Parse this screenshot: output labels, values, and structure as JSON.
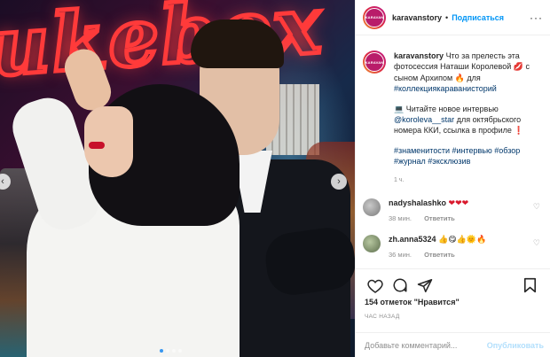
{
  "photo": {
    "neon_text": "ukebox",
    "nav_prev": "‹",
    "nav_next": "›",
    "carousel_dots": 4,
    "active_dot": 0
  },
  "header": {
    "username": "karavanstory",
    "separator": "•",
    "follow_label": "Подписаться",
    "more_label": "···",
    "avatar_text": "KARAVAN"
  },
  "caption": {
    "username": "karavanstory",
    "text1": "Что за прелесть эта фотосессия Наташи Королевой",
    "emoji_lips": "💋",
    "text2": "с сыном Архипом",
    "emoji_fire": "🔥",
    "text3": "для",
    "hashtag1": "#коллекциякараванисторий",
    "emoji_laptop": "💻",
    "text4": "Читайте новое интервью",
    "mention": "@koroleva__star",
    "text5": "для октябрьского номера ККИ, ссылка в профиле",
    "emoji_excl": "❗",
    "hashtags2": "#знаменитости #интервью #обзор #журнал #эксклюзив",
    "time": "1 ч."
  },
  "comments": [
    {
      "username": "nadyshalashko",
      "text": "❤❤❤",
      "time": "38 мин.",
      "reply_label": "Ответить"
    },
    {
      "username": "zh.anna5324",
      "text": "👍😋👍🌞🔥",
      "time": "36 мин.",
      "reply_label": "Ответить"
    }
  ],
  "actions": {
    "likes_count": "154 отметок",
    "likes_label": "\"Нравится\"",
    "ago": "ЧАС НАЗАД"
  },
  "add_comment": {
    "placeholder": "Добавьте комментарий...",
    "post_label": "Опубликовать"
  },
  "colors": {
    "accent": "#0095f6",
    "muted": "#8e8e8e",
    "post_disabled": "#b2dffc"
  }
}
